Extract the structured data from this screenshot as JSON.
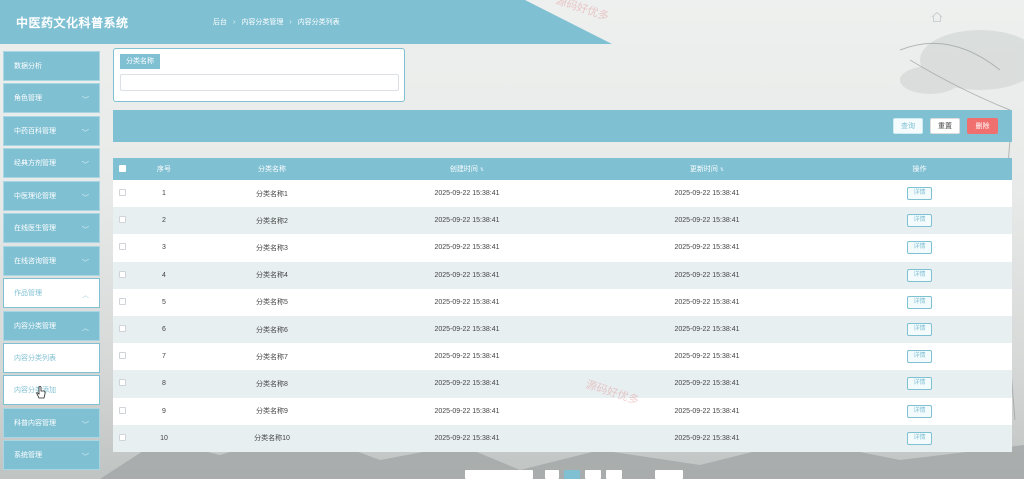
{
  "header": {
    "title": "中医药文化科普系统",
    "breadcrumb": [
      "后台",
      "内容分类管理",
      "内容分类列表"
    ],
    "breadcrumb_sep": "›"
  },
  "sidebar": {
    "items": [
      {
        "label": "数据分析",
        "chevron": "",
        "style": "normal"
      },
      {
        "label": "角色管理",
        "chevron": "﹀",
        "style": "normal"
      },
      {
        "label": "中药百科管理",
        "chevron": "﹀",
        "style": "normal"
      },
      {
        "label": "经典方剂管理",
        "chevron": "﹀",
        "style": "normal"
      },
      {
        "label": "中医理论管理",
        "chevron": "﹀",
        "style": "normal"
      },
      {
        "label": "在线医生管理",
        "chevron": "﹀",
        "style": "normal"
      },
      {
        "label": "在线咨询管理",
        "chevron": "﹀",
        "style": "normal"
      },
      {
        "label": "作品管理",
        "chevron": "︿",
        "style": "light"
      },
      {
        "label": "内容分类管理",
        "chevron": "︿",
        "style": "normal"
      },
      {
        "label": "内容分类列表",
        "chevron": "",
        "style": "light"
      },
      {
        "label": "内容分类添加",
        "chevron": "",
        "style": "light"
      },
      {
        "label": "科普内容管理",
        "chevron": "﹀",
        "style": "normal"
      },
      {
        "label": "系统管理",
        "chevron": "﹀",
        "style": "normal"
      }
    ]
  },
  "search": {
    "label": "分类名称",
    "value": "",
    "placeholder": ""
  },
  "actions": {
    "query": "查询",
    "reset": "重置",
    "delete": "删除"
  },
  "table": {
    "columns": [
      "序号",
      "分类名称",
      "创建时间",
      "更新时间",
      "操作"
    ],
    "rows": [
      {
        "no": "1",
        "name": "分类名称1",
        "created": "2025-09-22 15:38:41",
        "updated": "2025-09-22 15:38:41",
        "action": "详情"
      },
      {
        "no": "2",
        "name": "分类名称2",
        "created": "2025-09-22 15:38:41",
        "updated": "2025-09-22 15:38:41",
        "action": "详情"
      },
      {
        "no": "3",
        "name": "分类名称3",
        "created": "2025-09-22 15:38:41",
        "updated": "2025-09-22 15:38:41",
        "action": "详情"
      },
      {
        "no": "4",
        "name": "分类名称4",
        "created": "2025-09-22 15:38:41",
        "updated": "2025-09-22 15:38:41",
        "action": "详情"
      },
      {
        "no": "5",
        "name": "分类名称5",
        "created": "2025-09-22 15:38:41",
        "updated": "2025-09-22 15:38:41",
        "action": "详情"
      },
      {
        "no": "6",
        "name": "分类名称6",
        "created": "2025-09-22 15:38:41",
        "updated": "2025-09-22 15:38:41",
        "action": "详情"
      },
      {
        "no": "7",
        "name": "分类名称7",
        "created": "2025-09-22 15:38:41",
        "updated": "2025-09-22 15:38:41",
        "action": "详情"
      },
      {
        "no": "8",
        "name": "分类名称8",
        "created": "2025-09-22 15:38:41",
        "updated": "2025-09-22 15:38:41",
        "action": "详情"
      },
      {
        "no": "9",
        "name": "分类名称9",
        "created": "2025-09-22 15:38:41",
        "updated": "2025-09-22 15:38:41",
        "action": "详情"
      },
      {
        "no": "10",
        "name": "分类名称10",
        "created": "2025-09-22 15:38:41",
        "updated": "2025-09-22 15:38:41",
        "action": "详情"
      }
    ]
  },
  "watermark": "源码好优多",
  "colors": {
    "accent": "#7fc0d3",
    "danger": "#f07070",
    "row_alt": "#e8eff1"
  },
  "icons": {
    "home": "home-icon",
    "cursor": "hand-pointer-icon"
  }
}
